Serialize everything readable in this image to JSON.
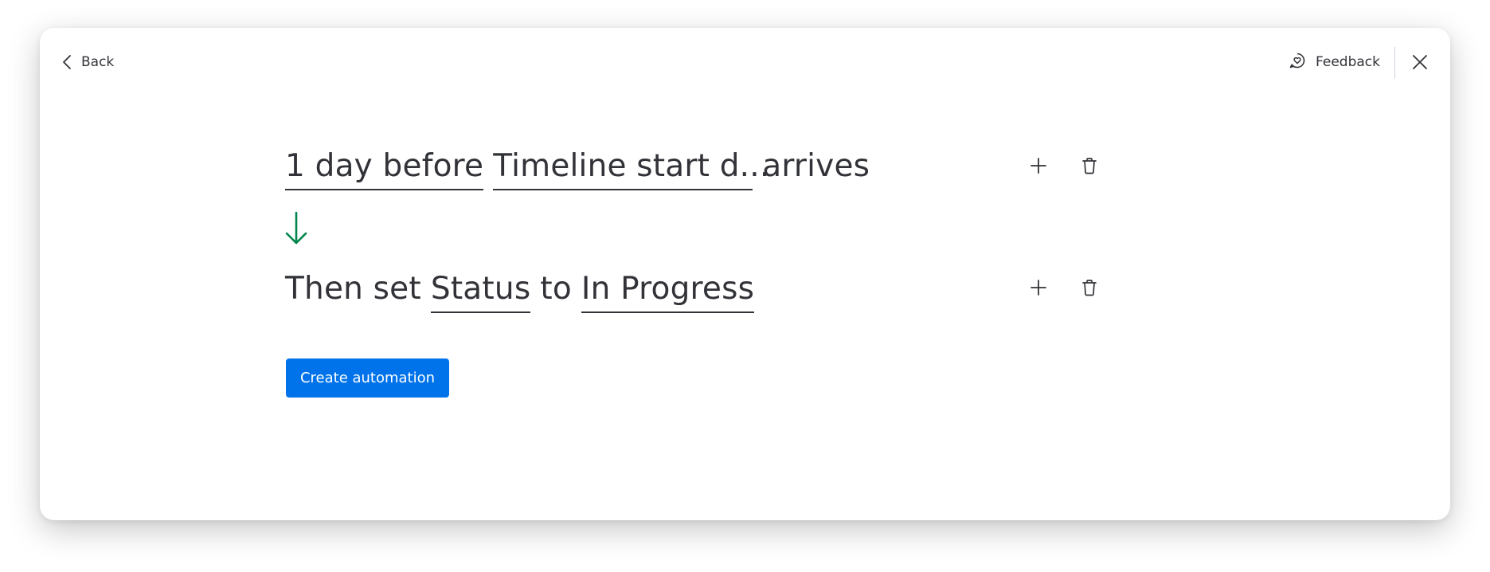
{
  "header": {
    "back_label": "Back",
    "feedback_label": "Feedback"
  },
  "trigger": {
    "offset_token": "1 day before",
    "column_token": "Timeline start d...",
    "suffix": "arrives"
  },
  "action": {
    "prefix": "Then set",
    "column_token": "Status",
    "connector": "to",
    "value_token": "In Progress"
  },
  "cta": {
    "label": "Create automation"
  },
  "colors": {
    "primary": "#0073ea",
    "arrow": "#00854d",
    "text": "#323338"
  },
  "icons": {
    "back": "chevron-left-icon",
    "feedback": "chat-heart-icon",
    "close": "close-icon",
    "add": "plus-icon",
    "delete": "trash-icon",
    "flow": "arrow-down-icon"
  }
}
